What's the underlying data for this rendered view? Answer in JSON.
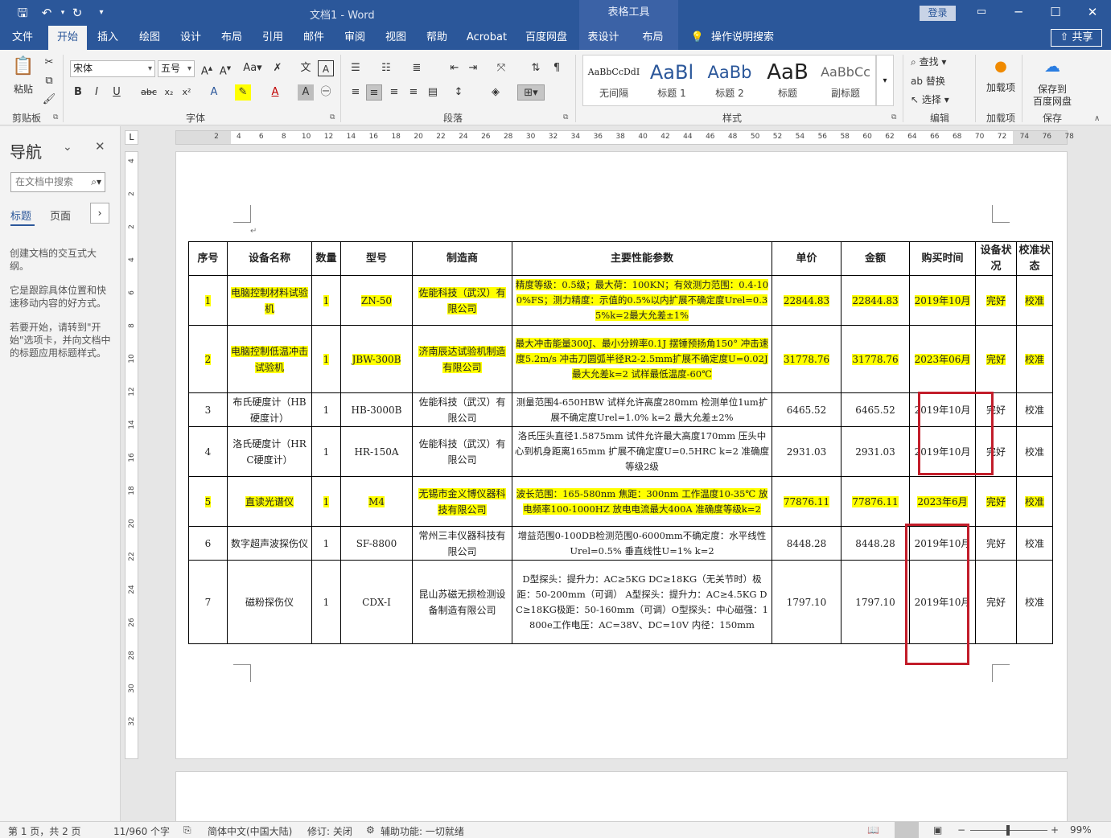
{
  "app": {
    "doc_title": "文档1 - Word",
    "context_tab": "表格工具",
    "login": "登录"
  },
  "tabs": [
    {
      "label": "文件"
    },
    {
      "label": "开始"
    },
    {
      "label": "插入"
    },
    {
      "label": "绘图"
    },
    {
      "label": "设计"
    },
    {
      "label": "布局"
    },
    {
      "label": "引用"
    },
    {
      "label": "邮件"
    },
    {
      "label": "审阅"
    },
    {
      "label": "视图"
    },
    {
      "label": "帮助"
    },
    {
      "label": "Acrobat"
    },
    {
      "label": "百度网盘"
    },
    {
      "label": "表设计"
    },
    {
      "label": "布局"
    }
  ],
  "tell_me": "操作说明搜索",
  "share": "共享",
  "ribbon": {
    "clipboard": {
      "paste": "粘贴",
      "label": "剪贴板"
    },
    "font": {
      "name": "宋体",
      "size": "五号",
      "label": "字体"
    },
    "paragraph": {
      "label": "段落"
    },
    "styles": {
      "label": "样式",
      "items": [
        {
          "preview": "AaBbCcDdI",
          "name": "无间隔"
        },
        {
          "preview": "AaBl",
          "name": "标题 1"
        },
        {
          "preview": "AaBb",
          "name": "标题 2"
        },
        {
          "preview": "AaB",
          "name": "标题"
        },
        {
          "preview": "AaBbCc",
          "name": "副标题"
        }
      ]
    },
    "editing": {
      "find": "查找",
      "replace": "替换",
      "select": "选择",
      "label": "编辑"
    },
    "addins": {
      "button": "加载项",
      "label": "加载项"
    },
    "save": {
      "button1": "保存到",
      "button2": "百度网盘",
      "label": "保存"
    }
  },
  "nav": {
    "title": "导航",
    "search_placeholder": "在文档中搜索",
    "tab_headings": "标题",
    "tab_pages": "页面",
    "p1": "创建文档的交互式大纲。",
    "p2": "它是跟踪具体位置和快速移动内容的好方式。",
    "p3": "若要开始，请转到\"开始\"选项卡，并向文档中的标题应用标题样式。"
  },
  "ruler": {
    "h": [
      "2",
      "4",
      "6",
      "8",
      "10",
      "12",
      "14",
      "16",
      "18",
      "20",
      "22",
      "24",
      "26",
      "28",
      "30",
      "32",
      "34",
      "36",
      "38",
      "40",
      "42",
      "44",
      "46",
      "48",
      "50",
      "52",
      "54",
      "56",
      "58",
      "60",
      "62",
      "64",
      "66",
      "68",
      "70",
      "72",
      "74",
      "76",
      "78"
    ],
    "v": [
      "4",
      "2",
      "2",
      "4",
      "6",
      "8",
      "10",
      "12",
      "14",
      "16",
      "18",
      "20",
      "22",
      "24",
      "26",
      "28",
      "30",
      "32"
    ]
  },
  "table": {
    "headers": [
      "序号",
      "设备名称",
      "数量",
      "型号",
      "制造商",
      "主要性能参数",
      "单价",
      "金额",
      "购买时间",
      "设备状况",
      "校准状态"
    ],
    "rows": [
      {
        "hl": true,
        "cells": [
          "1",
          "电脑控制材料试验机",
          "1",
          "ZN-50",
          "佐能科技（武汉）有限公司",
          "精度等级：0.5级；最大荷：100KN；有效测力范围：0.4-100%FS；测力精度：示值的0.5%以内扩展不确定度Urel=0.35%k=2最大允差±1%",
          "22844.83",
          "22844.83",
          "2019年10月",
          "完好",
          "校准"
        ]
      },
      {
        "hl": true,
        "cells": [
          "2",
          "电脑控制低温冲击试验机",
          "1",
          "JBW-300B",
          "济南辰达试验机制造有限公司",
          "最大冲击能量300J、最小分辨率0.1J 摆锤预扬角150° 冲击速度5.2m/s 冲击刀圆弧半径R2-2.5mm扩展不确定度U=0.02J最大允差k=2 试样最低温度-60℃",
          "31778.76",
          "31778.76",
          "2023年06月",
          "完好",
          "校准"
        ]
      },
      {
        "hl": false,
        "cells": [
          "3",
          "布氏硬度计（HB硬度计）",
          "1",
          "HB-3000B",
          "佐能科技（武汉）有限公司",
          "测量范围4-650HBW 试样允许高度280mm 检测单位1um扩展不确定度Urel=1.0% k=2 最大允差±2%",
          "6465.52",
          "6465.52",
          "2019年10月",
          "完好",
          "校准"
        ]
      },
      {
        "hl": false,
        "cells": [
          "4",
          "洛氏硬度计（HRC硬度计）",
          "1",
          "HR-150A",
          "佐能科技（武汉）有限公司",
          "洛氏压头直径1.5875mm 试件允许最大高度170mm 压头中心到机身距离165mm 扩展不确定度U=0.5HRC k=2 准确度等级2级",
          "2931.03",
          "2931.03",
          "2019年10月",
          "完好",
          "校准"
        ]
      },
      {
        "hl": true,
        "cells": [
          "5",
          "直读光谱仪",
          "1",
          "M4",
          "无锡市金义博仪器科技有限公司",
          "波长范围：165-580nm 焦距：300nm 工作温度10-35℃ 放电频率100-1000HZ 放电电流最大400A 准确度等级k=2",
          "77876.11",
          "77876.11",
          "2023年6月",
          "完好",
          "校准"
        ]
      },
      {
        "hl": false,
        "cells": [
          "6",
          "数字超声波探伤仪",
          "1",
          "SF-8800",
          "常州三丰仪器科技有限公司",
          "增益范围0-100DB检测范围0-6000mm不确定度：水平线性Urel=0.5% 垂直线性U=1% k=2",
          "8448.28",
          "8448.28",
          "2019年10月",
          "完好",
          "校准"
        ]
      },
      {
        "hl": false,
        "cells": [
          "7",
          "磁粉探伤仪",
          "1",
          "CDX-I",
          "昆山苏磁无损检测设备制造有限公司",
          "D型探头：提升力：AC≥5KG DC≥18KG（无关节时）极距：50-200mm（可调） A型探头：提升力：AC≥4.5KG DC≥18KG极距：50-160mm（可调）O型探头：中心磁强：1800e工作电压：AC=38V、DC=10V 内径：150mm",
          "1797.10",
          "1797.10",
          "2019年10月",
          "完好",
          "校准"
        ]
      }
    ]
  },
  "status": {
    "page": "第 1 页，共 2 页",
    "words": "11/960 个字",
    "lang": "简体中文(中国大陆)",
    "track": "修订: 关闭",
    "access": "辅助功能: 一切就绪",
    "zoom": "99%"
  }
}
